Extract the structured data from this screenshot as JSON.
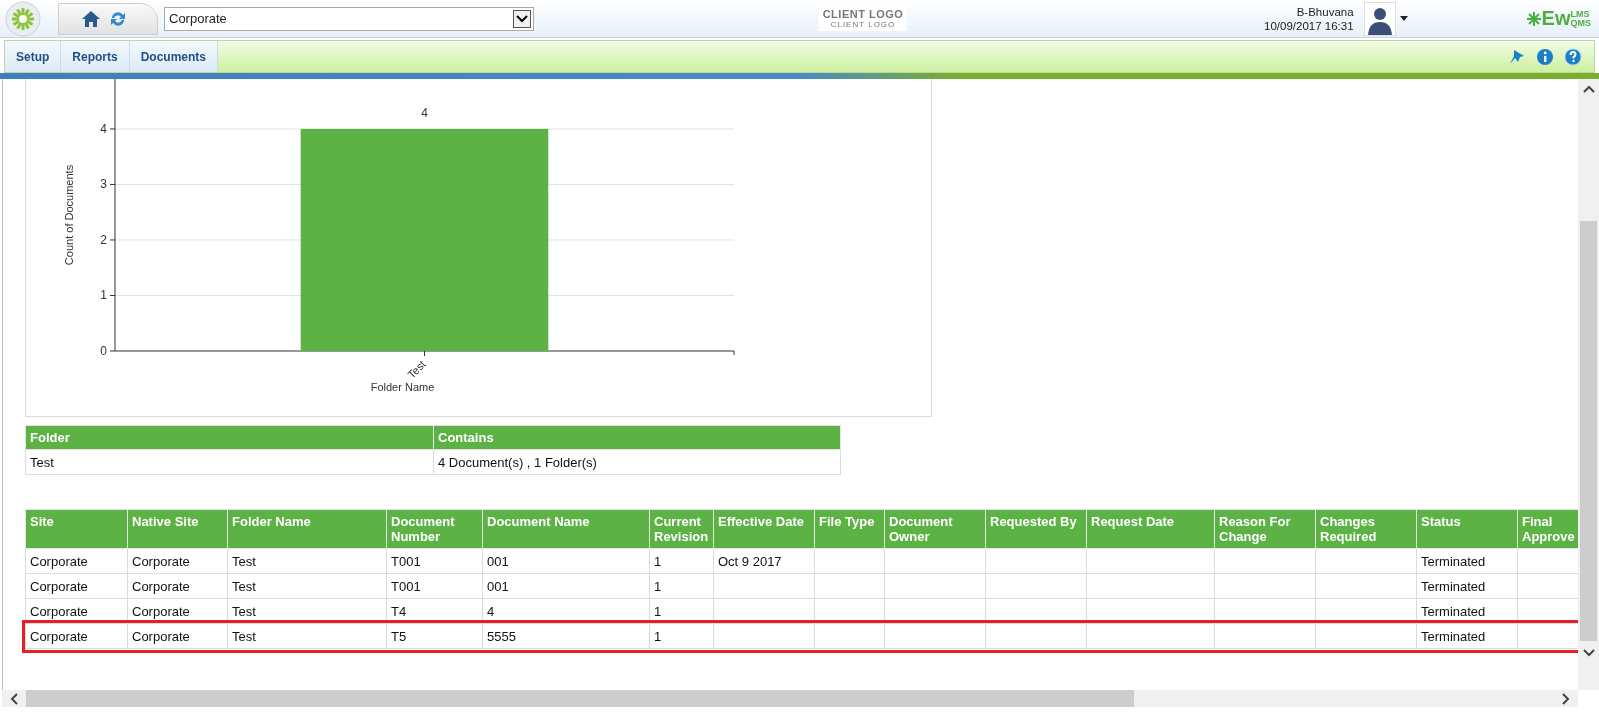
{
  "header": {
    "site_select": {
      "value": "Corporate"
    },
    "client_logo": {
      "title": "CLIENT LOGO",
      "subtitle": "CLIENT LOGO"
    },
    "user": {
      "name": "B-Bhuvana",
      "datetime": "10/09/2017 16:31"
    },
    "brand": {
      "main": "Ew",
      "sub": "QMS",
      "top": "LMS"
    }
  },
  "menu": [
    {
      "label": "Setup",
      "selected": false
    },
    {
      "label": "Reports",
      "selected": false
    },
    {
      "label": "Documents",
      "selected": false
    }
  ],
  "chart": {
    "chart_data": {
      "type": "bar",
      "xlabel": "Folder Name",
      "ylabel": "Count of Documents",
      "categories": [
        "Test"
      ],
      "values": [
        4
      ],
      "ylim": [
        0,
        4.9
      ],
      "yticks": [
        0,
        1,
        2,
        3,
        4
      ],
      "grid": true,
      "data_labels": true
    }
  },
  "folder_table": {
    "columns": [
      "Folder",
      "Contains"
    ],
    "rows": [
      [
        "Test",
        "4 Document(s) , 1 Folder(s)"
      ]
    ]
  },
  "documents_table": {
    "columns": [
      "Site",
      "Native Site",
      "Folder Name",
      "Document Number",
      "Document Name",
      "Current Revision",
      "Effective Date",
      "File Type",
      "Document Owner",
      "Requested By",
      "Request Date",
      "Reason For Change",
      "Changes Required",
      "Status",
      "Final Approve"
    ],
    "rows": [
      {
        "highlighted": false,
        "cells": [
          "Corporate",
          "Corporate",
          "Test",
          "T001",
          "001",
          "1",
          "Oct 9 2017",
          "",
          "",
          "",
          "",
          "",
          "",
          "Terminated",
          ""
        ]
      },
      {
        "highlighted": false,
        "cells": [
          "Corporate",
          "Corporate",
          "Test",
          "T001",
          "001",
          "1",
          "",
          "",
          "",
          "",
          "",
          "",
          "",
          "Terminated",
          ""
        ]
      },
      {
        "highlighted": false,
        "cells": [
          "Corporate",
          "Corporate",
          "Test",
          "T4",
          "4",
          "1",
          "",
          "",
          "",
          "",
          "",
          "",
          "",
          "Terminated",
          ""
        ]
      },
      {
        "highlighted": true,
        "cells": [
          "Corporate",
          "Corporate",
          "Test",
          "T5",
          "5555",
          "1",
          "",
          "",
          "",
          "",
          "",
          "",
          "",
          "Terminated",
          ""
        ]
      }
    ]
  }
}
